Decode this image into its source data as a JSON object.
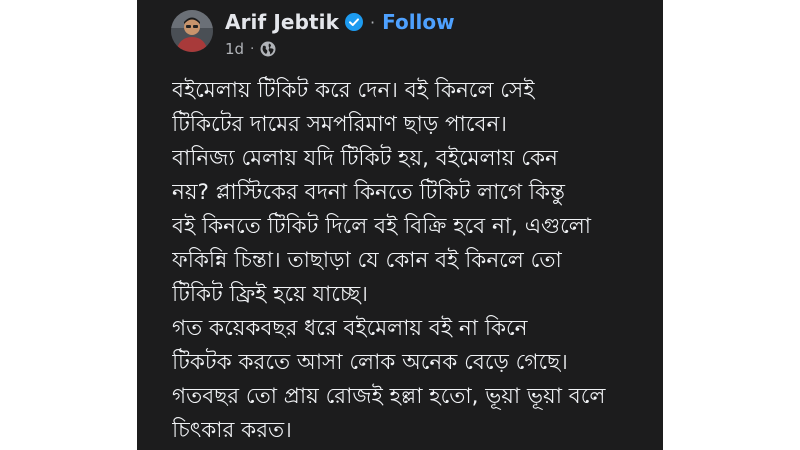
{
  "author": {
    "name": "Arif Jebtik",
    "verified_icon": "verified-badge-icon",
    "follow_label": "Follow",
    "separator": "·"
  },
  "meta": {
    "timestamp": "1d",
    "separator": "·",
    "audience_icon": "globe-icon"
  },
  "post": {
    "lines": [
      "বইমেলায় টিকিট করে দেন। বই কিনলে সেই",
      "টিকিটের দামের সমপরিমাণ ছাড় পাবেন।",
      "বানিজ্য মেলায় যদি টিকিট হয়, বইমেলায় কেন",
      "নয়? প্লাস্টিকের বদনা কিনতে টিকিট লাগে কিন্তু",
      "বই কিনতে টিকিট দিলে বই বিক্রি হবে না, এগুলো",
      "ফকিন্নি চিন্তা। তাছাড়া যে কোন বই কিনলে তো",
      "টিকিট ফ্রিই হয়ে যাচ্ছে।",
      "গত কয়েকবছর ধরে বইমেলায় বই না কিনে",
      "টিকটক করতে আসা লোক অনেক বেড়ে গেছে।",
      "গতবছর তো প্রায় রোজই হল্লা হতো, ভূয়া ভূয়া বলে",
      "চিৎকার করত।"
    ]
  },
  "colors": {
    "card_background": "#1c1c1d",
    "page_background": "#ffffff",
    "text_primary": "#f0f2f5",
    "text_secondary": "#b0b3b8",
    "link_blue": "#4ea1ff",
    "verified_blue": "#1d9bf0"
  }
}
